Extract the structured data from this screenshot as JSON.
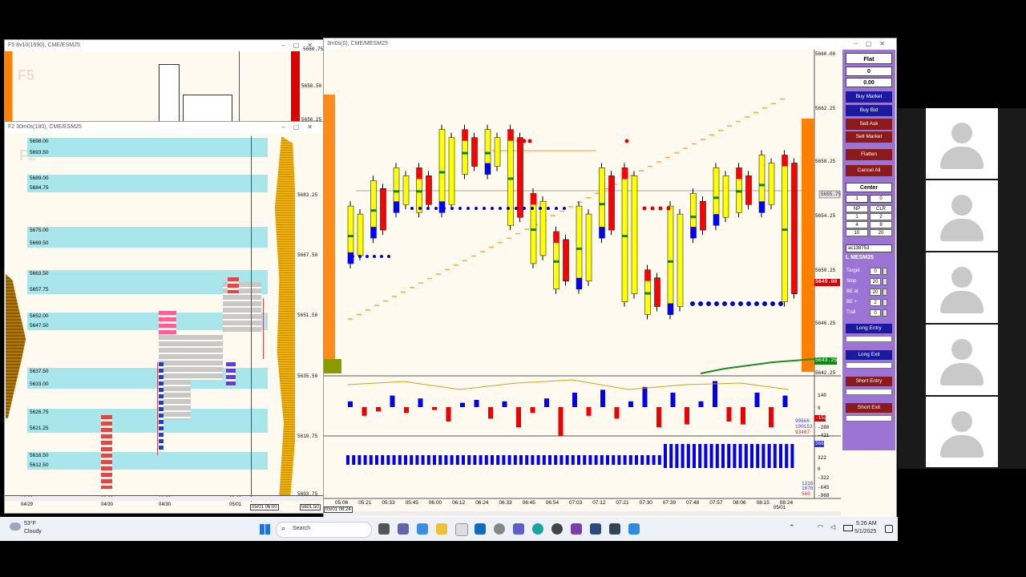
{
  "windows": {
    "f5": {
      "title": "F5 8v10(1690), CME/ESM25",
      "watermark": "F5",
      "prices": [
        "5660.75",
        "5658.50",
        "5656.25"
      ]
    },
    "f2": {
      "title": "F2 30m0s(180), CME/ESM25",
      "watermark": "F2",
      "band_labels": [
        "5698.00",
        "5693.50",
        "5689.00",
        "5684.75",
        "5675.00",
        "5669.50",
        "5663.50",
        "5657.75",
        "5652.00",
        "5647.50",
        "5637.50",
        "5633.00",
        "5626.75",
        "5621.25",
        "5616.50",
        "5612.50"
      ],
      "price_axis": [
        "5683.25",
        "5667.50",
        "5651.50",
        "5635.50",
        "5619.75",
        "5603.75"
      ],
      "x_labels": [
        {
          "t": "18:00",
          "d": "04/29"
        },
        {
          "t": "09:30",
          "d": "04/30"
        },
        {
          "t": "18:00",
          "d": "04/30"
        },
        {
          "t": "03:00",
          "d": "05/01"
        }
      ],
      "cursor_time": "05/01 06:00",
      "cursor_price": "5601.50"
    },
    "main": {
      "title": "3m0s(0), CME/MESM25",
      "price_axis": [
        "5660.00",
        "5662.25",
        "5658.25",
        "5654.25",
        "5650.25",
        "5646.25",
        "5642.25"
      ],
      "current_price": "5649.00",
      "tag_price": "5655.75",
      "green_price": "5643.25",
      "osc1_axis": [
        "140",
        "0",
        "-280",
        "-421"
      ],
      "osc1_tags": [
        "99666",
        "190153",
        "93487"
      ],
      "osc1_badge": "-152",
      "osc2_axis": [
        "322",
        "0",
        "-322",
        "-645",
        "-968"
      ],
      "osc2_tags": [
        "1316",
        "1876"
      ],
      "osc2_badge": "366",
      "osc2_last": "560",
      "time_labels": [
        "05:06",
        "05:21",
        "05:33",
        "05:45",
        "06:00",
        "06:12",
        "06:24",
        "06:33",
        "06:45",
        "06:54",
        "07:03",
        "07:12",
        "07:21",
        "07:30",
        "07:39",
        "07:48",
        "07:57",
        "08:06",
        "08:15",
        "08:24"
      ],
      "last_date": "05/01",
      "cursor_time": "05/01 08:24"
    }
  },
  "trade_panel": {
    "position": "Flat",
    "qty": "0",
    "pnl": "0.00",
    "buttons": [
      "Buy Market",
      "Buy Bid",
      "Sell Ask",
      "Sell Market",
      "Flatten",
      "Cancel All",
      "Center"
    ],
    "qty_row": [
      "1",
      "0"
    ],
    "grid": [
      [
        "NP",
        "CLR"
      ],
      [
        "1",
        "2"
      ],
      [
        "4",
        "8"
      ],
      [
        "10",
        "20"
      ]
    ],
    "account": "ac138753",
    "symbol": "L MESM25",
    "params": [
      {
        "k": "Target",
        "v": "0"
      },
      {
        "k": "Stop",
        "v": "20"
      },
      {
        "k": "BE at",
        "v": "20"
      },
      {
        "k": "BE +",
        "v": "2"
      },
      {
        "k": "Trail",
        "v": "0"
      }
    ],
    "entries": [
      "Long Entry",
      "Long Exit",
      "Short Entry",
      "Short Exit"
    ]
  },
  "taskbar": {
    "temp": "53°F",
    "weather": "Cloudy",
    "search": "Search",
    "time": "5:26 AM",
    "date": "5/1/2025"
  },
  "colors": {
    "accent_purple": "#9b74d6",
    "band": "#a8e6ec",
    "bar_yellow": "#ffff00",
    "bar_red": "#ff0000",
    "bar_blue": "#0000ff",
    "orange": "#ff8000"
  },
  "chart_data": {
    "type": "bar",
    "title": "",
    "xlabel": "",
    "ylabel": "",
    "categories": [
      "05:06",
      "05:21",
      "05:33",
      "05:45",
      "06:00",
      "06:12",
      "06:24",
      "06:33",
      "06:45",
      "06:54",
      "07:03",
      "07:12",
      "07:21",
      "07:30",
      "07:39",
      "07:48",
      "07:57",
      "08:06",
      "08:15",
      "08:24"
    ],
    "series": [
      {
        "values": [
          5654,
          5656,
          5657,
          5656,
          5660,
          5659,
          5660,
          5655,
          5652,
          5650,
          5654,
          5657,
          5649,
          5648,
          5654,
          5655,
          5657,
          5656,
          5658,
          5649
        ]
      }
    ],
    "ylim": [
      5642,
      5664
    ]
  }
}
